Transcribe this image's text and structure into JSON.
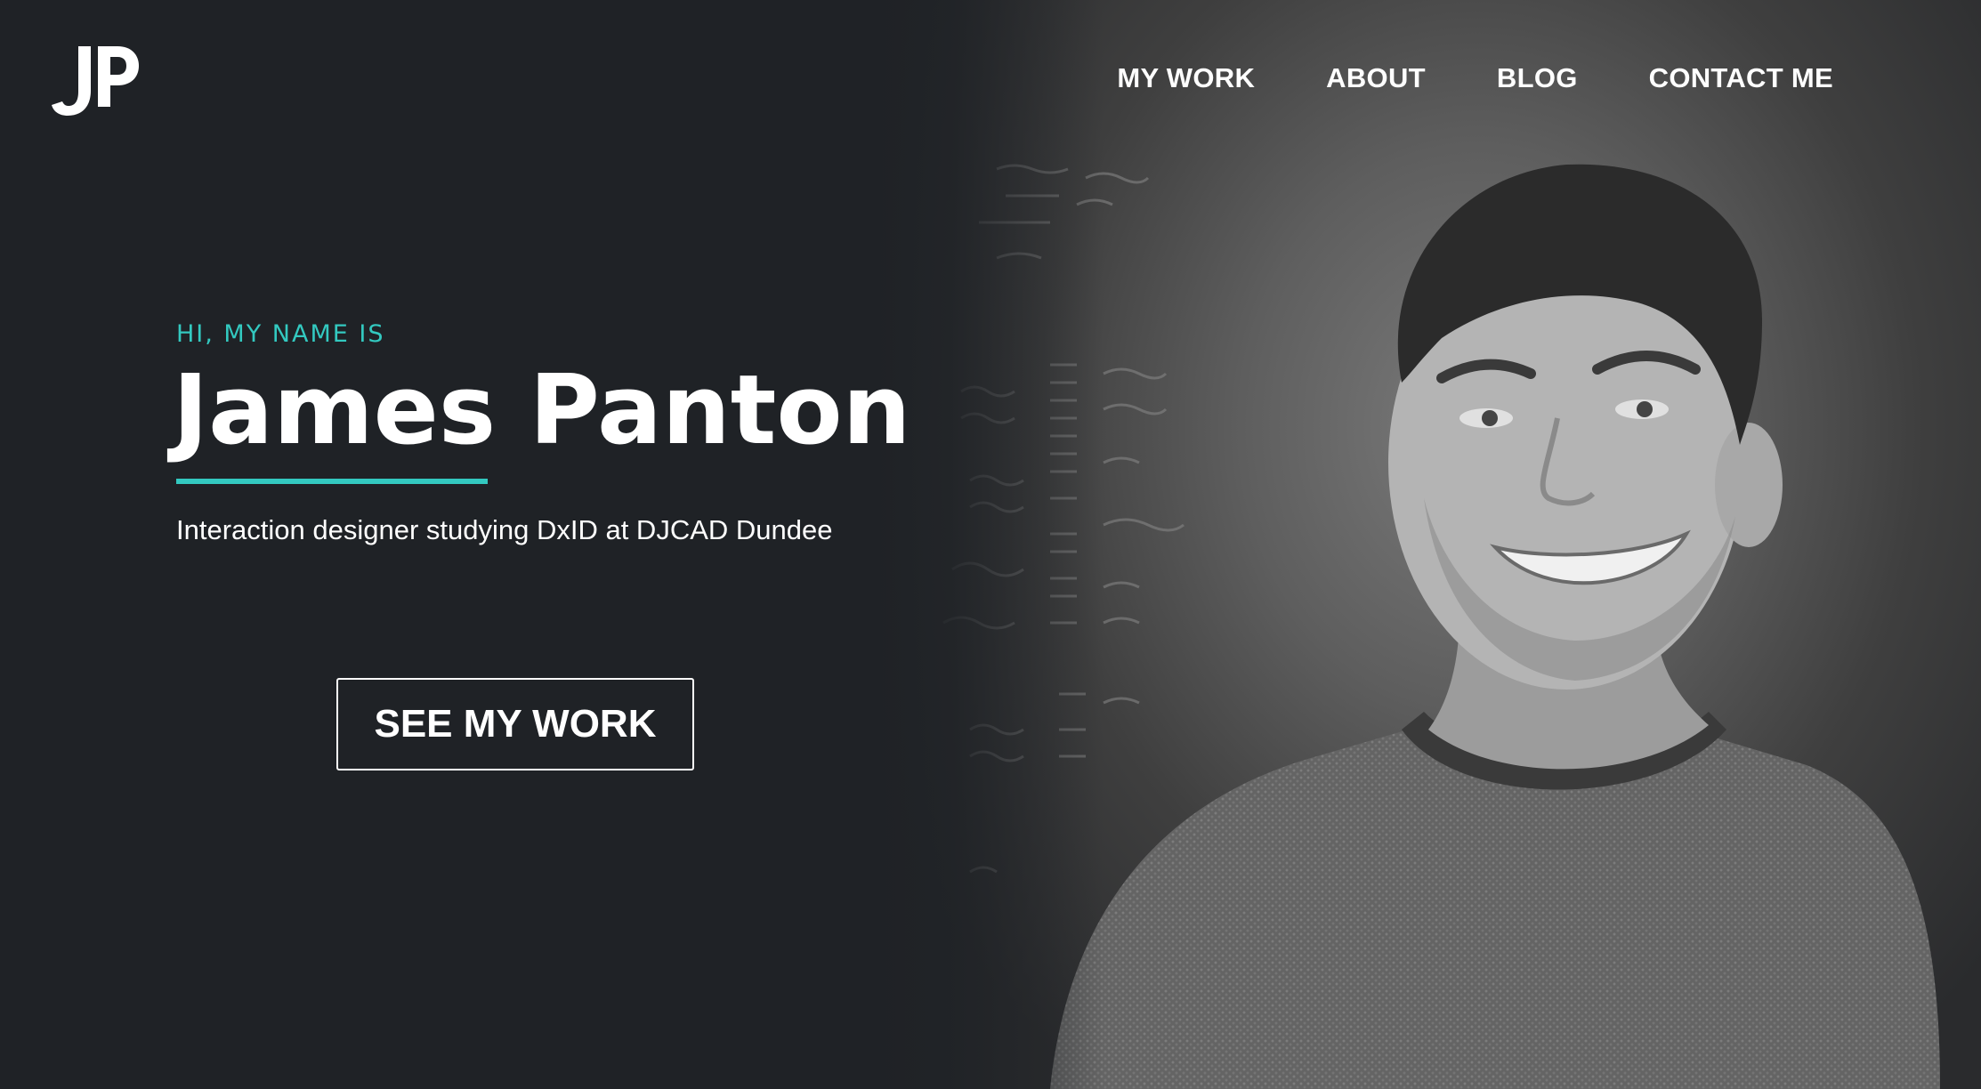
{
  "header": {
    "logo_text": "JP",
    "nav": [
      {
        "label": "MY WORK"
      },
      {
        "label": "ABOUT"
      },
      {
        "label": "BLOG"
      },
      {
        "label": "CONTACT ME"
      }
    ]
  },
  "hero": {
    "greeting": "HI, MY NAME IS",
    "name": "James Panton",
    "tagline": "Interaction designer studying DxID at DJCAD Dundee",
    "cta_label": "SEE MY WORK"
  },
  "colors": {
    "background": "#1f2226",
    "accent": "#33c9c0",
    "text": "#ffffff"
  },
  "icons": {
    "logo": "jp-monogram-logo"
  }
}
